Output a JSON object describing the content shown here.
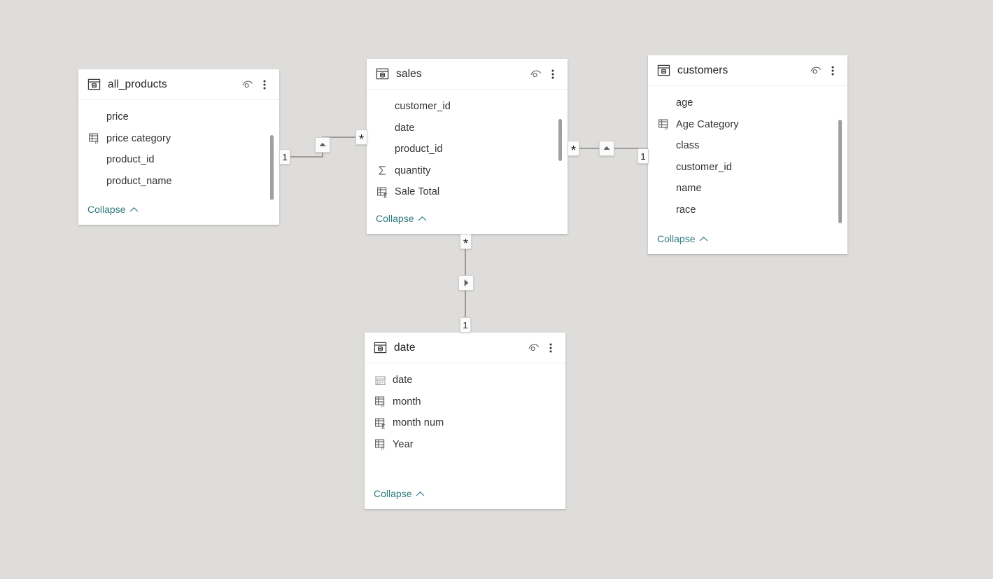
{
  "canvas": {
    "background_color": "#dedddb",
    "card_background_color": "#ffffff",
    "accent_link_color": "#307a7f",
    "text_color": "#323130",
    "title_color": "#252423"
  },
  "tables": [
    {
      "id": "all_products",
      "name": "all_products",
      "table_icon": "table-icon",
      "hide_icon": "hidden-eye-icon",
      "more_icon": "more-options-icon",
      "collapse_label": "Collapse",
      "collapse_icon": "chevron-up-icon",
      "scrollbar": true,
      "fields": [
        {
          "name": "price",
          "icon": "none"
        },
        {
          "name": "price category",
          "icon": "calculated-column-icon"
        },
        {
          "name": "product_id",
          "icon": "none"
        },
        {
          "name": "product_name",
          "icon": "none"
        }
      ]
    },
    {
      "id": "sales",
      "name": "sales",
      "table_icon": "table-icon",
      "hide_icon": "hidden-eye-icon",
      "more_icon": "more-options-icon",
      "collapse_label": "Collapse",
      "collapse_icon": "chevron-up-icon",
      "scrollbar": true,
      "fields": [
        {
          "name": "customer_id",
          "icon": "none"
        },
        {
          "name": "date",
          "icon": "none"
        },
        {
          "name": "product_id",
          "icon": "none"
        },
        {
          "name": "quantity",
          "icon": "sum-sigma-icon"
        },
        {
          "name": "Sale Total",
          "icon": "measure-icon"
        }
      ]
    },
    {
      "id": "customers",
      "name": "customers",
      "table_icon": "table-icon",
      "hide_icon": "hidden-eye-icon",
      "more_icon": "more-options-icon",
      "collapse_label": "Collapse",
      "collapse_icon": "chevron-up-icon",
      "scrollbar": true,
      "fields": [
        {
          "name": "age",
          "icon": "none"
        },
        {
          "name": "Age Category",
          "icon": "calculated-column-icon"
        },
        {
          "name": "class",
          "icon": "none"
        },
        {
          "name": "customer_id",
          "icon": "none"
        },
        {
          "name": "name",
          "icon": "none"
        },
        {
          "name": "race",
          "icon": "none"
        }
      ]
    },
    {
      "id": "date",
      "name": "date",
      "table_icon": "table-icon",
      "hide_icon": "hidden-eye-icon",
      "more_icon": "more-options-icon",
      "collapse_label": "Collapse",
      "collapse_icon": "chevron-up-icon",
      "scrollbar": false,
      "fields": [
        {
          "name": "date",
          "icon": "calendar-icon"
        },
        {
          "name": "month",
          "icon": "calculated-column-icon"
        },
        {
          "name": "month num",
          "icon": "measure-icon"
        },
        {
          "name": "Year",
          "icon": "calculated-column-icon"
        }
      ]
    }
  ],
  "relationships": [
    {
      "id": "all_products-sales",
      "from_table": "all_products",
      "to_table": "sales",
      "from_cardinality": "1",
      "to_cardinality": "*",
      "cross_filter_icon": "filter-direction-up-icon"
    },
    {
      "id": "sales-customers",
      "from_table": "sales",
      "to_table": "customers",
      "from_cardinality": "*",
      "to_cardinality": "1",
      "cross_filter_icon": "filter-direction-up-icon"
    },
    {
      "id": "sales-date",
      "from_table": "sales",
      "to_table": "date",
      "from_cardinality": "*",
      "to_cardinality": "1",
      "cross_filter_icon": "filter-direction-right-icon"
    }
  ]
}
